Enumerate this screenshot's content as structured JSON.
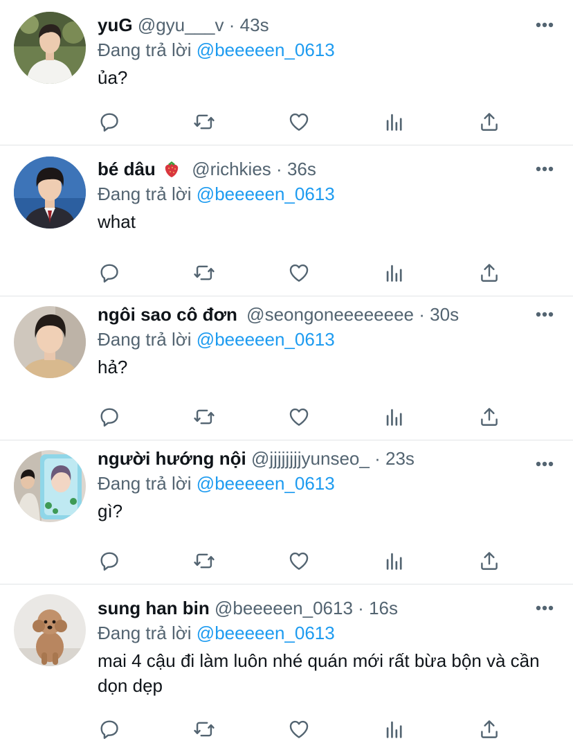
{
  "tweets": [
    {
      "display_name": "yuG",
      "emoji": "",
      "handle": "@gyu___v",
      "separator": "·",
      "time": "43s",
      "reply_prefix": "Đang trả lời",
      "reply_to": "@beeeeen_0613",
      "text": "ủa?",
      "avatar_icon": "avatar-photo-boy-white-shirt"
    },
    {
      "display_name": "bé dâu",
      "emoji": "strawberry",
      "handle": "@richkies",
      "separator": "·",
      "time": "36s",
      "reply_prefix": "Đang trả lời",
      "reply_to": "@beeeeen_0613",
      "text": "what",
      "avatar_icon": "avatar-photo-boy-school-uniform"
    },
    {
      "display_name": "ngôi sao cô đơn",
      "emoji": "",
      "handle": "@seongoneeeeeeee",
      "separator": "·",
      "time": "30s",
      "reply_prefix": "Đang trả lời",
      "reply_to": "@beeeeen_0613",
      "text": "hả?",
      "avatar_icon": "avatar-photo-boy-closeup"
    },
    {
      "display_name": "người hướng nội",
      "emoji": "",
      "handle": "@jjjjjjjjyunseo_",
      "separator": "·",
      "time": "23s",
      "reply_prefix": "Đang trả lời",
      "reply_to": "@beeeeen_0613",
      "text": "gì?",
      "avatar_icon": "avatar-photo-fan-with-poster"
    },
    {
      "display_name": "sung han bin",
      "emoji": "",
      "handle": "@beeeeen_0613",
      "separator": "·",
      "time": "16s",
      "reply_prefix": "Đang trả lời",
      "reply_to": "@beeeeen_0613",
      "text": "mai 4 cậu đi làm luôn nhé quán mới rất bừa bộn và cần dọn dẹp",
      "avatar_icon": "avatar-photo-poodle-dog"
    }
  ],
  "actions": [
    "reply-icon",
    "retweet-icon",
    "like-icon",
    "views-icon",
    "share-icon"
  ],
  "colors": {
    "link": "#1d9bf0",
    "secondary_text": "#536471",
    "primary_text": "#0f1419",
    "icon": "#536471",
    "divider": "#e1e4e6"
  }
}
